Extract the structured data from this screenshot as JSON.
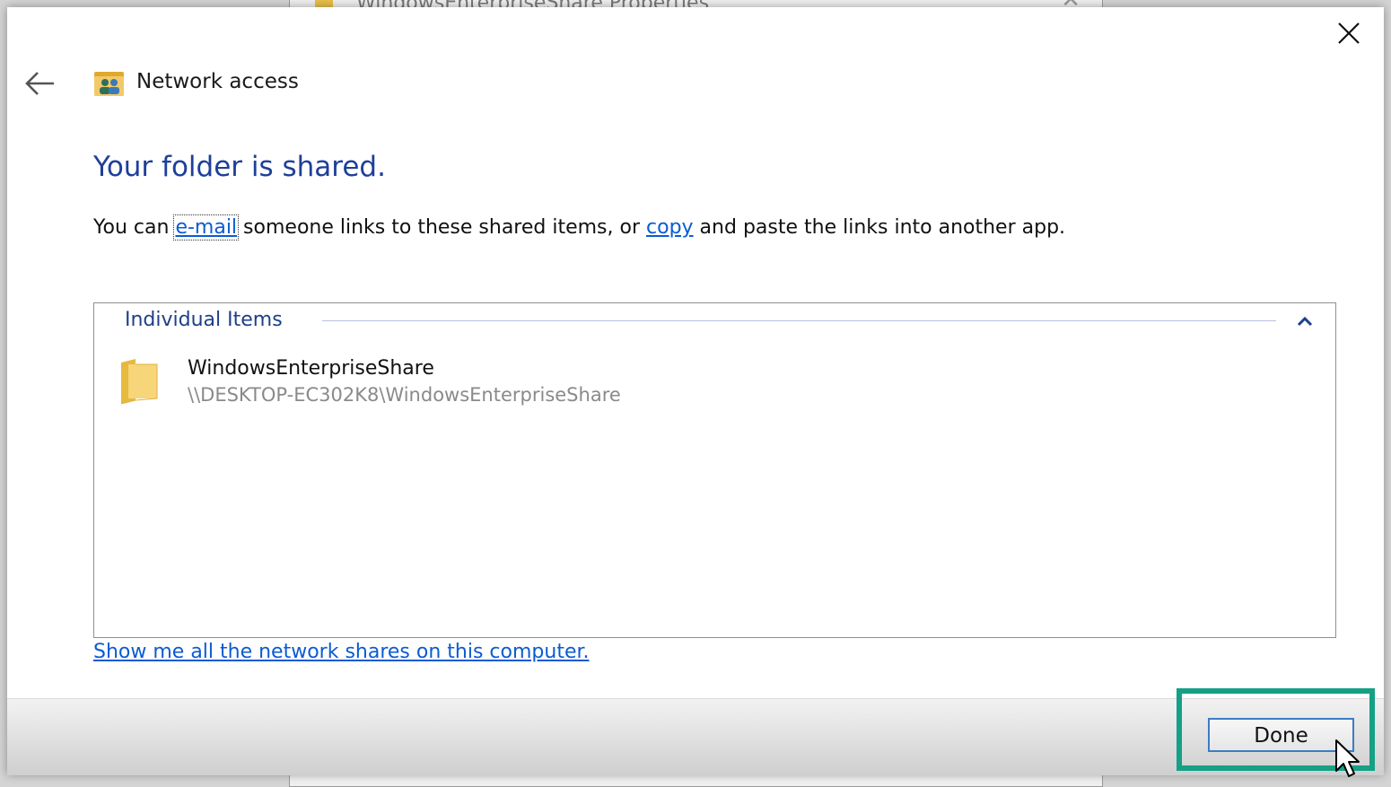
{
  "background_window": {
    "title": "WindowsEnterpriseShare Properties"
  },
  "dialog": {
    "header_title": "Network access",
    "heading": "Your folder is shared.",
    "description": {
      "prefix": "You can ",
      "email_link": "e-mail",
      "middle": " someone links to these shared items, or ",
      "copy_link": "copy",
      "suffix": " and paste the links into another app."
    },
    "group": {
      "label": "Individual Items",
      "items": [
        {
          "name": "WindowsEnterpriseShare",
          "path": "\\\\DESKTOP-EC302K8\\WindowsEnterpriseShare"
        }
      ]
    },
    "show_shares_link": "Show me all the network shares on this computer.",
    "done_label": "Done"
  },
  "colors": {
    "heading": "#1e3f9a",
    "link": "#0b5bd3",
    "highlight": "#16a085"
  },
  "icons": [
    "close-icon",
    "back-arrow-icon",
    "network-access-icon",
    "chevron-up-icon",
    "folder-icon",
    "mouse-cursor-icon"
  ]
}
